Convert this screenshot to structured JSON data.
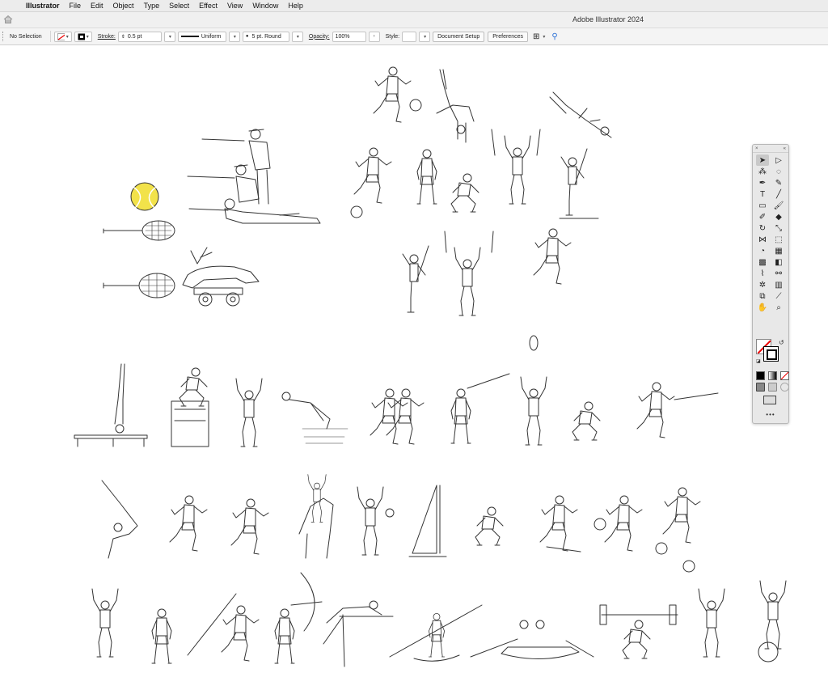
{
  "menubar": {
    "apple_glyph": "",
    "app_name": "Illustrator",
    "items": [
      "File",
      "Edit",
      "Object",
      "Type",
      "Select",
      "Effect",
      "View",
      "Window",
      "Help"
    ]
  },
  "titlebar": {
    "title": "Adobe Illustrator 2024"
  },
  "control_bar": {
    "selection_label": "No Selection",
    "stroke_label": "Stroke:",
    "stroke_weight": "0.5 pt",
    "profile_label": "Uniform",
    "brush_label": "5 pt. Round",
    "opacity_label": "Opacity:",
    "opacity_value": "100%",
    "style_label": "Style:",
    "document_setup_label": "Document Setup",
    "preferences_label": "Preferences"
  },
  "toolbar": {
    "more_label": "•••",
    "tools": [
      {
        "name": "selection-tool",
        "glyph": "➤",
        "active": true
      },
      {
        "name": "direct-selection-tool",
        "glyph": "▷",
        "active": false
      },
      {
        "name": "magic-wand-tool",
        "glyph": "⁂",
        "active": false
      },
      {
        "name": "lasso-tool",
        "glyph": "◌",
        "active": false
      },
      {
        "name": "pen-tool",
        "glyph": "✒",
        "active": false
      },
      {
        "name": "curvature-tool",
        "glyph": "✎",
        "active": false
      },
      {
        "name": "type-tool",
        "glyph": "T",
        "active": false
      },
      {
        "name": "line-tool",
        "glyph": "╱",
        "active": false
      },
      {
        "name": "rectangle-tool",
        "glyph": "▭",
        "active": false
      },
      {
        "name": "paintbrush-tool",
        "glyph": "🖌",
        "active": false
      },
      {
        "name": "shaper-tool",
        "glyph": "✐",
        "active": false
      },
      {
        "name": "eraser-tool",
        "glyph": "◆",
        "active": false
      },
      {
        "name": "rotate-tool",
        "glyph": "↻",
        "active": false
      },
      {
        "name": "scale-tool",
        "glyph": "⤡",
        "active": false
      },
      {
        "name": "width-tool",
        "glyph": "⋈",
        "active": false
      },
      {
        "name": "free-transform-tool",
        "glyph": "⬚",
        "active": false
      },
      {
        "name": "shape-builder-tool",
        "glyph": "◔",
        "active": false
      },
      {
        "name": "perspective-grid-tool",
        "glyph": "▦",
        "active": false
      },
      {
        "name": "mesh-tool",
        "glyph": "▩",
        "active": false
      },
      {
        "name": "gradient-tool",
        "glyph": "◧",
        "active": false
      },
      {
        "name": "eyedropper-tool",
        "glyph": "⌇",
        "active": false
      },
      {
        "name": "blend-tool",
        "glyph": "⚯",
        "active": false
      },
      {
        "name": "symbol-sprayer-tool",
        "glyph": "✲",
        "active": false
      },
      {
        "name": "column-graph-tool",
        "glyph": "▥",
        "active": false
      },
      {
        "name": "artboard-tool",
        "glyph": "⧉",
        "active": false
      },
      {
        "name": "slice-tool",
        "glyph": "⟋",
        "active": false
      },
      {
        "name": "hand-tool",
        "glyph": "✋",
        "active": false
      },
      {
        "name": "zoom-tool",
        "glyph": "⌕",
        "active": false
      }
    ]
  },
  "colors": {
    "accent_yellow": "#f2e24a",
    "stroke_default": "#333333"
  }
}
